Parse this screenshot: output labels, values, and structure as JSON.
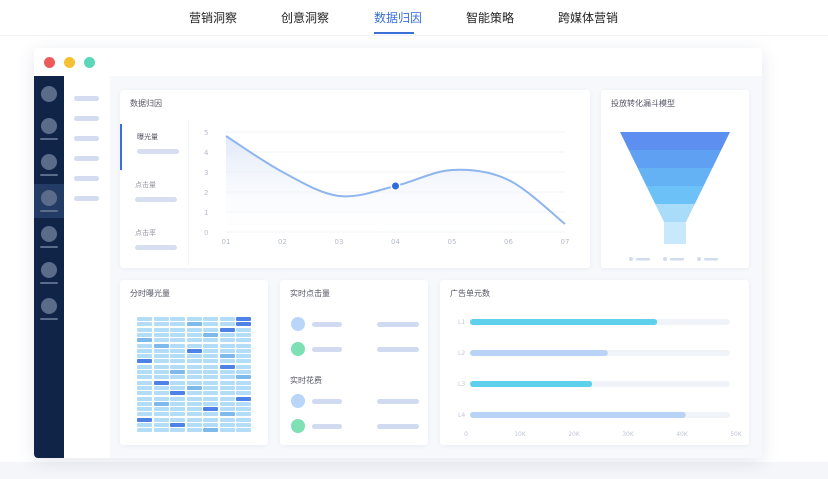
{
  "nav": {
    "items": [
      "营销洞察",
      "创意洞察",
      "数据归因",
      "智能策略",
      "跨媒体营销"
    ],
    "active_index": 2
  },
  "window": {
    "controls": [
      {
        "name": "close",
        "color": "#ec5b5b"
      },
      {
        "name": "minimize",
        "color": "#f5c033"
      },
      {
        "name": "maximize",
        "color": "#5cd6b8"
      }
    ]
  },
  "attribution_card": {
    "title": "数据归因",
    "tabs": [
      "曝光量",
      "点击量",
      "点击率"
    ],
    "active_tab": 0,
    "chart_data": {
      "type": "line",
      "x": [
        "01",
        "02",
        "03",
        "04",
        "05",
        "06",
        "07"
      ],
      "y_ticks": [
        "0",
        "1",
        "2",
        "3",
        "4",
        "5"
      ],
      "ylim": [
        0,
        5
      ],
      "series": [
        {
          "values": [
            4.8,
            3.0,
            1.8,
            2.3,
            3.1,
            2.6,
            0.4
          ]
        }
      ],
      "highlight_x": "04",
      "colors": {
        "line": "#8fb5ee",
        "fill_top": "#dde7f8",
        "point": "#2d6be0"
      }
    }
  },
  "funnel_card": {
    "title": "投放转化漏斗模型",
    "chart_data": {
      "type": "funnel",
      "levels": 5,
      "colors": [
        "#5c8ff0",
        "#5fa0f2",
        "#64b1f4",
        "#6cc1f6",
        "#a8dcf8"
      ]
    }
  },
  "heatmap_card": {
    "title": "分时曝光量",
    "chart_data": {
      "type": "heatmap",
      "rows": 22,
      "cols": 7,
      "colors": {
        "low": "#b3dcf6",
        "mid": "#7eb9ec",
        "high": "#4f82e6"
      }
    }
  },
  "realtime_card": {
    "title_clicks": "实时点击量",
    "title_spend": "实时花费",
    "dot_colors": [
      "#b9d6f9",
      "#7ee0b5"
    ]
  },
  "ad_units_card": {
    "title": "广告单元数",
    "chart_data": {
      "type": "bar",
      "orientation": "horizontal",
      "categories": [
        "L1",
        "L2",
        "L3",
        "L4"
      ],
      "values": [
        72,
        53,
        47,
        83
      ],
      "x_ticks": [
        "0",
        "10K",
        "20K",
        "30K",
        "40K",
        "50K"
      ],
      "colors": [
        "#5ed0ec",
        "#b8d3f6",
        "#5ed0ec",
        "#b8d3f6"
      ]
    }
  }
}
